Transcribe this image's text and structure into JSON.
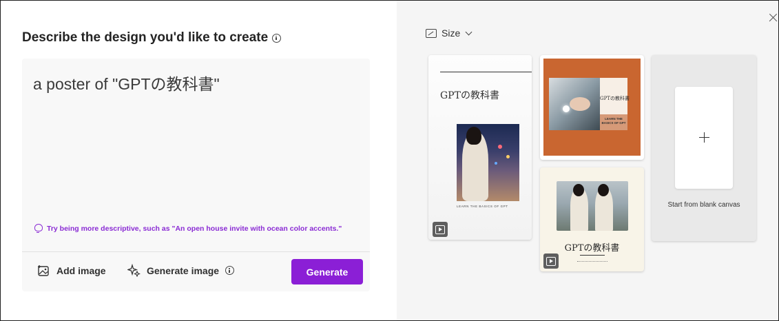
{
  "left_panel": {
    "heading": "Describe the design you'd like to create",
    "prompt_value": "a poster of \"GPTの教科書\"",
    "tip": "Try being more descriptive, such as \"An open house invite with ocean color accents.\"",
    "add_image_label": "Add image",
    "generate_image_label": "Generate image",
    "generate_button": "Generate",
    "accent_color": "#8b1fd6"
  },
  "right_panel": {
    "size_label": "Size",
    "templates": [
      {
        "title": "GPTの教科書",
        "subtitle": "LEARN THE BASICS OF GPT"
      },
      {
        "title": "GPTの教科書",
        "subtitle": "LEARN THE\nBASICS OF GPT",
        "background_color": "#c96630"
      },
      {
        "title": "GPTの教科書"
      }
    ],
    "blank_canvas_label": "Start from blank canvas"
  }
}
